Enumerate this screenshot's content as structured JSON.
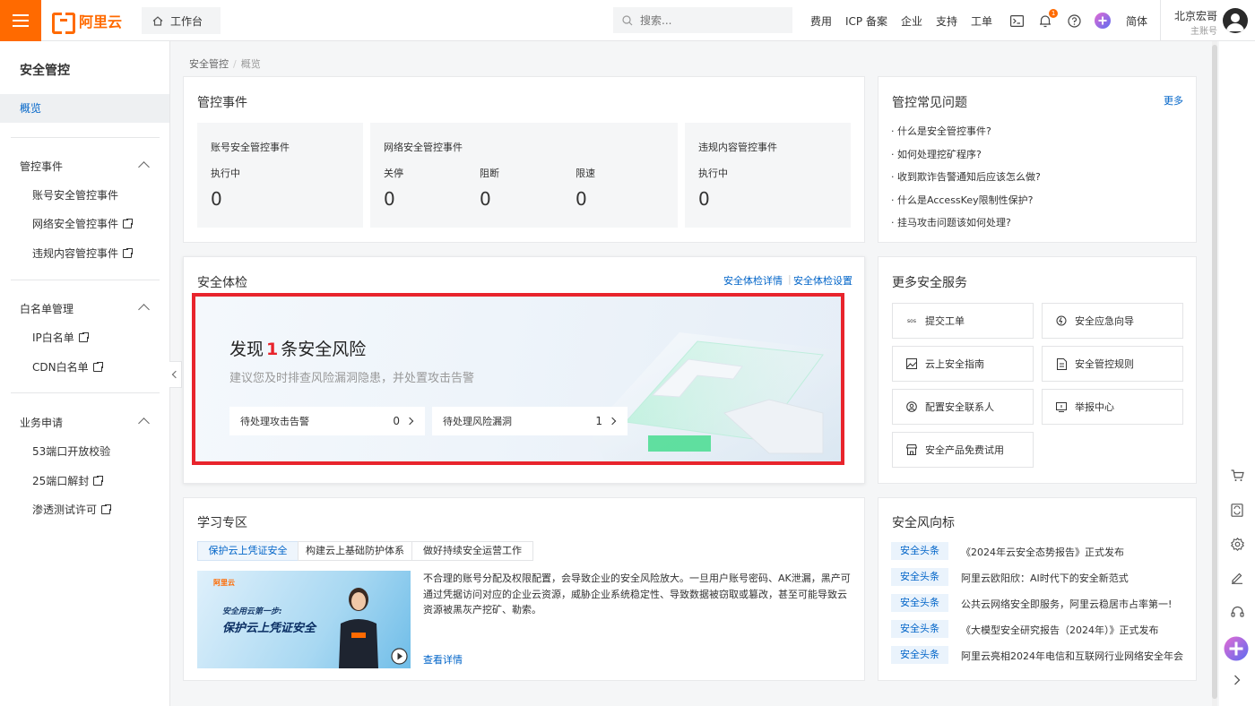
{
  "topbar": {
    "logo_text": "阿里云",
    "workbench_label": "工作台",
    "search_placeholder": "搜索...",
    "nav": [
      "费用",
      "ICP 备案",
      "企业",
      "支持",
      "工单"
    ],
    "notification_count": "1",
    "lang_label": "简体",
    "user_name": "北京宏哥",
    "user_role": "主账号",
    "accent_color": "#ff6a00"
  },
  "sidebar": {
    "title": "安全管控",
    "overview_label": "概览",
    "groups": [
      {
        "label": "管控事件",
        "items": [
          "账号安全管控事件",
          "网络安全管控事件",
          "违规内容管控事件"
        ]
      },
      {
        "label": "白名单管理",
        "items": [
          "IP白名单",
          "CDN白名单"
        ]
      },
      {
        "label": "业务申请",
        "items": [
          "53端口开放校验",
          "25端口解封",
          "渗透测试许可"
        ]
      }
    ]
  },
  "breadcrumb": {
    "root": "安全管控",
    "sep": "/",
    "current": "概览"
  },
  "events": {
    "title": "管控事件",
    "account": {
      "title": "账号安全管控事件",
      "label": "执行中",
      "value": "0"
    },
    "network": {
      "title": "网络安全管控事件",
      "items": [
        {
          "label": "关停",
          "value": "0"
        },
        {
          "label": "阻断",
          "value": "0"
        },
        {
          "label": "限速",
          "value": "0"
        }
      ]
    },
    "content": {
      "title": "违规内容管控事件",
      "label": "执行中",
      "value": "0"
    }
  },
  "check": {
    "title": "安全体检",
    "link_detail": "安全体检详情",
    "link_sep": "|",
    "link_settings": "安全体检设置",
    "headline_prefix": "发现",
    "risk_count": "1",
    "headline_suffix": "条安全风险",
    "subtitle": "建议您及时排查风险漏洞隐患，并处置攻击告警",
    "pending_alerts_label": "待处理攻击告警",
    "pending_alerts_value": "0",
    "pending_vulns_label": "待处理风险漏洞",
    "pending_vulns_value": "1",
    "highlight_color": "#e8242c"
  },
  "faq": {
    "title": "管控常见问题",
    "more": "更多",
    "items": [
      "什么是安全管控事件?",
      "如何处理挖矿程序?",
      "收到欺诈告警通知后应该怎么做?",
      "什么是AccessKey限制性保护?",
      "挂马攻击问题该如何处理?"
    ]
  },
  "services": {
    "title": "更多安全服务",
    "sos_glyph": "sos",
    "items": [
      "提交工单",
      "安全应急向导",
      "云上安全指南",
      "安全管控规则",
      "配置安全联系人",
      "举报中心",
      "安全产品免费试用"
    ]
  },
  "learn": {
    "title": "学习专区",
    "tabs": [
      "保护云上凭证安全",
      "构建云上基础防护体系",
      "做好持续安全运营工作"
    ],
    "thumb_logo": "阿里云",
    "thumb_line1": "安全用云第一步:",
    "thumb_line2": "保护云上凭证安全",
    "text": "不合理的账号分配及权限配置，会导致企业的安全风险放大。一旦用户账号密码、AK泄漏，黑产可通过凭据访问对应的企业云资源，威胁企业系统稳定性、导致数据被窃取或篡改，甚至可能导致云资源被黑灰产挖矿、勒索。",
    "link": "查看详情"
  },
  "news": {
    "title": "安全风向标",
    "tag": "安全头条",
    "items": [
      "《2024年云安全态势报告》正式发布",
      "阿里云欧阳欣：AI时代下的安全新范式",
      "公共云网络安全即服务，阿里云稳居市占率第一!",
      "《大模型安全研究报告（2024年）》正式发布",
      "阿里云亮相2024年电信和互联网行业网络安全年会"
    ]
  }
}
